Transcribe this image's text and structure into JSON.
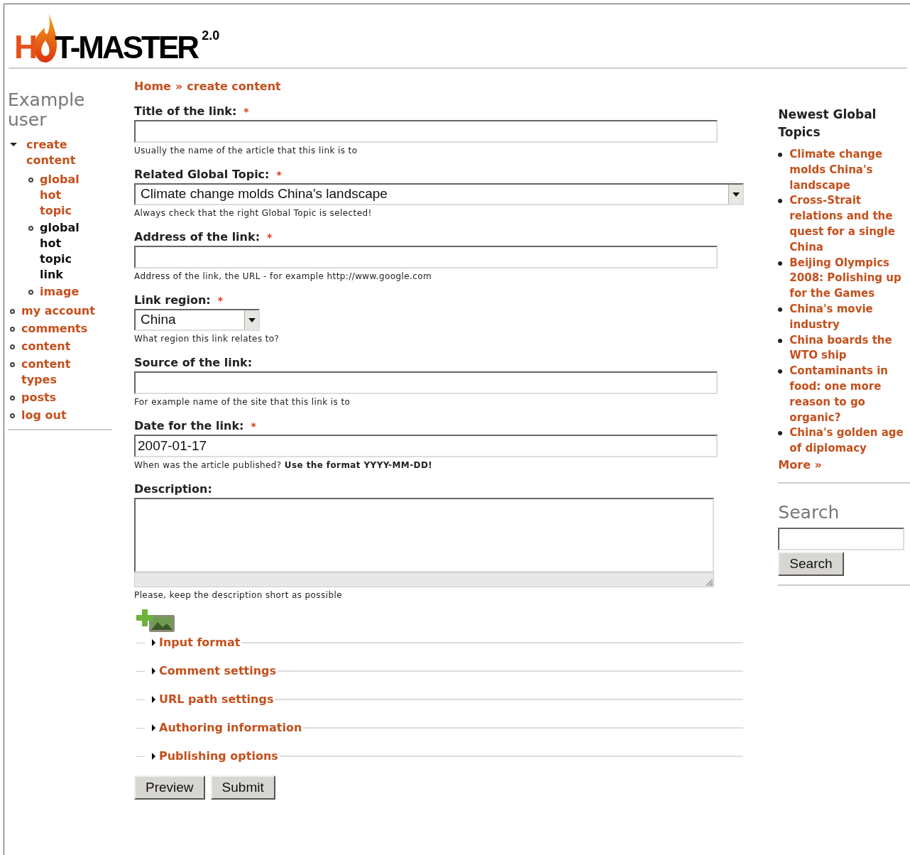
{
  "logo": {
    "text_before": "H",
    "text_after": "T-MASTER",
    "version": "2.0"
  },
  "user_menu": {
    "title": "Example user",
    "items": [
      {
        "label": "create content",
        "selected": false,
        "expanded": true,
        "children": [
          {
            "label": "global hot topic",
            "selected": false
          },
          {
            "label": "global hot topic link",
            "selected": true
          },
          {
            "label": "image",
            "selected": false
          }
        ]
      },
      {
        "label": "my account",
        "selected": false
      },
      {
        "label": "comments",
        "selected": false
      },
      {
        "label": "content",
        "selected": false
      },
      {
        "label": "content types",
        "selected": false
      },
      {
        "label": "posts",
        "selected": false
      },
      {
        "label": "log out",
        "selected": false
      }
    ]
  },
  "breadcrumb": [
    {
      "label": "Home"
    },
    {
      "label": "create content"
    }
  ],
  "breadcrumb_separator": "»",
  "form": {
    "fields": [
      {
        "kind": "text",
        "label": "Title of the link:",
        "required": true,
        "description": "Usually the name of the article that this link is to"
      },
      {
        "kind": "select",
        "label": "Related Global Topic:",
        "required": true,
        "value": "Climate change molds China's landscape",
        "description": "Always check that the right Global Topic is selected!"
      },
      {
        "kind": "text",
        "label": "Address of the link:",
        "required": true,
        "description": "Address of the link, the URL - for example http://www.google.com"
      },
      {
        "kind": "select_small",
        "label": "Link region:",
        "required": true,
        "value": "China",
        "description": "What region this link relates to?"
      },
      {
        "kind": "text",
        "label": "Source of the link:",
        "required": false,
        "description": "For example name of the site that this link is to"
      },
      {
        "kind": "text",
        "label": "Date for the link:",
        "required": true,
        "value": "2007-01-17",
        "description": "When was the article published? **Use the format YYYY-MM-DD!**"
      },
      {
        "kind": "textarea",
        "label": "Description:",
        "required": false,
        "description": "Please, keep the description short as possible"
      }
    ],
    "fieldsets": [
      {
        "label": "Input format",
        "expanded": false
      },
      {
        "label": "Comment settings",
        "expanded": false
      },
      {
        "label": "URL path settings",
        "expanded": false
      },
      {
        "label": "Authoring information",
        "expanded": false
      },
      {
        "label": "Publishing options",
        "expanded": false
      }
    ],
    "buttons": [
      "Preview",
      "Submit"
    ]
  },
  "newest_topics": {
    "title": "Newest Global Topics",
    "items": [
      "Climate change molds China's landscape",
      "Cross-Strait relations and the quest for a single China",
      "Beijing Olympics 2008: Polishing up for the Games",
      "China's movie industry",
      "China boards the WTO ship",
      "Contaminants in food: one more reason to go organic?",
      "China's golden age of diplomacy"
    ],
    "more": "More »"
  },
  "required_marker": "*",
  "search": {
    "title": "Search",
    "button": "Search"
  }
}
